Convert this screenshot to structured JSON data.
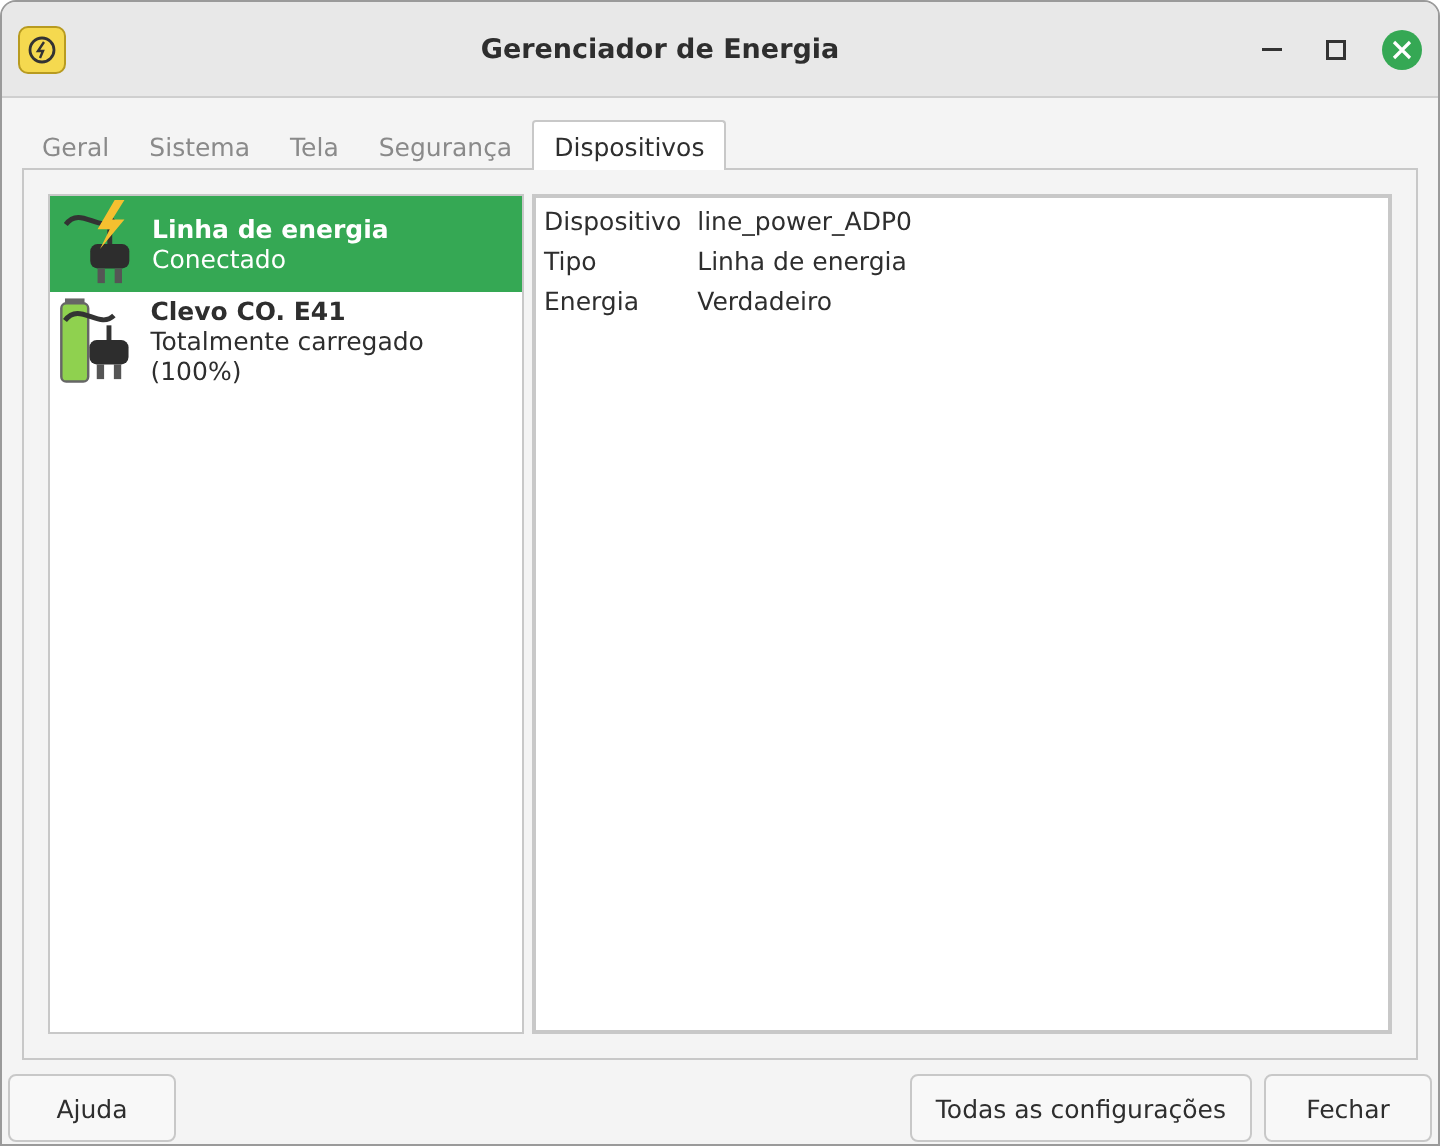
{
  "window": {
    "title": "Gerenciador de Energia"
  },
  "tabs": [
    {
      "label": "Geral",
      "selected": false
    },
    {
      "label": "Sistema",
      "selected": false
    },
    {
      "label": "Tela",
      "selected": false
    },
    {
      "label": "Segurança",
      "selected": false
    },
    {
      "label": "Dispositivos",
      "selected": true
    }
  ],
  "devices": [
    {
      "kind": "power",
      "name": "Linha de energia",
      "status": "Conectado",
      "selected": true
    },
    {
      "kind": "battery",
      "name": "Clevo CO. E41",
      "status": "Totalmente carregado (100%)",
      "selected": false
    }
  ],
  "details": [
    {
      "label": "Dispositivo",
      "value": "line_power_ADP0"
    },
    {
      "label": "Tipo",
      "value": "Linha de energia"
    },
    {
      "label": "Energia",
      "value": "Verdadeiro"
    }
  ],
  "buttons_left": [
    "Ajuda"
  ],
  "buttons_right": [
    "Todas as configurações",
    "Fechar"
  ]
}
